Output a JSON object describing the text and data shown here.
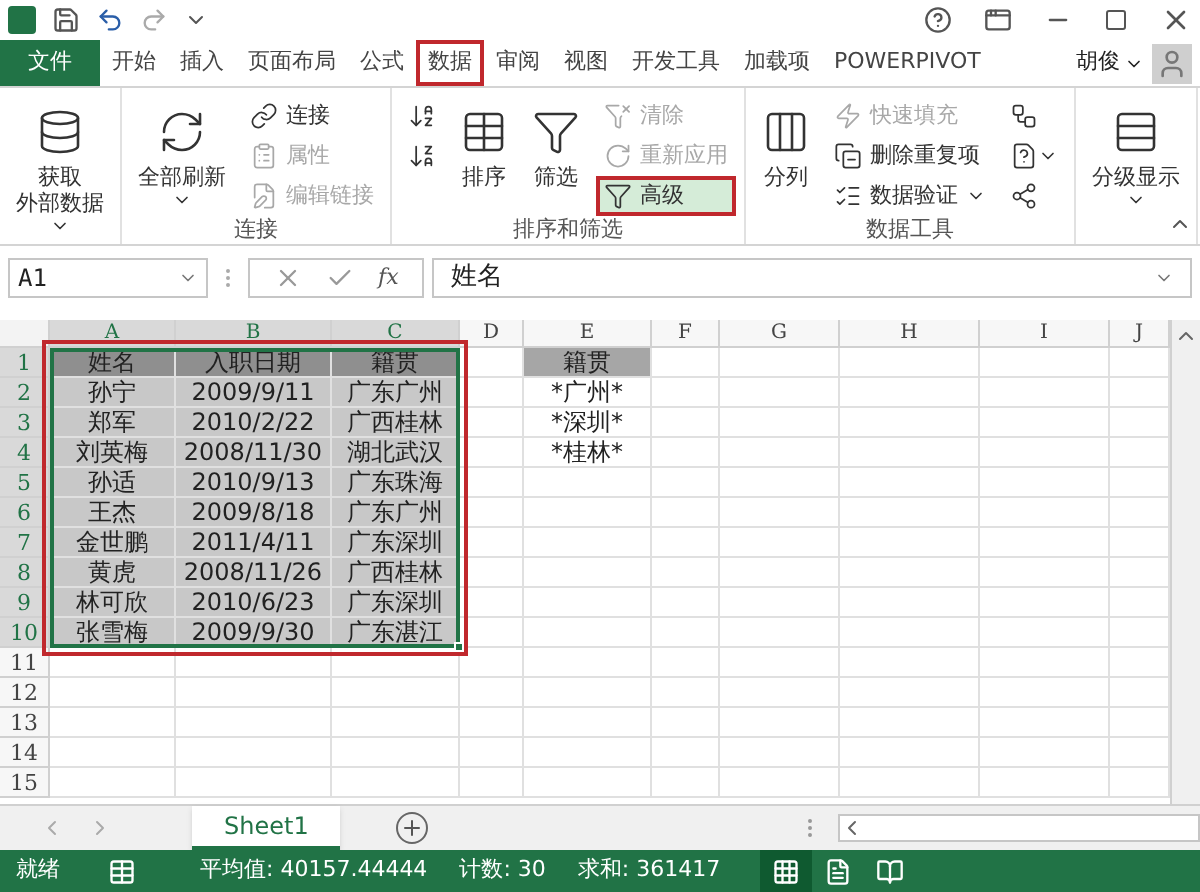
{
  "tabs": [
    {
      "label": "文件",
      "kind": "file",
      "selected": false
    },
    {
      "label": "开始",
      "kind": "tab",
      "selected": false
    },
    {
      "label": "插入",
      "kind": "tab",
      "selected": false
    },
    {
      "label": "页面布局",
      "kind": "tab",
      "selected": false
    },
    {
      "label": "公式",
      "kind": "tab",
      "selected": false
    },
    {
      "label": "数据",
      "kind": "tab",
      "selected": true
    },
    {
      "label": "审阅",
      "kind": "tab",
      "selected": false
    },
    {
      "label": "视图",
      "kind": "tab",
      "selected": false
    },
    {
      "label": "开发工具",
      "kind": "tab",
      "selected": false
    },
    {
      "label": "加载项",
      "kind": "tab",
      "selected": false
    },
    {
      "label": "POWERPIVOT",
      "kind": "tab",
      "selected": false
    }
  ],
  "user": {
    "name": "胡俊"
  },
  "ribbon": {
    "groups": [
      {
        "stacks": [
          [
            {
              "kind": "large",
              "lines": [
                "获取",
                "外部数据"
              ],
              "dropdown": true,
              "disabled": false,
              "highlighted": false
            }
          ]
        ]
      },
      {
        "label": "连接",
        "stacks": [
          [
            {
              "kind": "large",
              "lines": [
                "全部刷新"
              ],
              "dropdown": true,
              "disabled": false,
              "highlighted": false
            }
          ],
          [
            {
              "kind": "small",
              "lines": [
                "连接"
              ],
              "dropdown": false,
              "disabled": false,
              "highlighted": false
            },
            {
              "kind": "small",
              "lines": [
                "属性"
              ],
              "dropdown": false,
              "disabled": true,
              "highlighted": false
            },
            {
              "kind": "small",
              "lines": [
                "编辑链接"
              ],
              "dropdown": false,
              "disabled": true,
              "highlighted": false
            }
          ]
        ]
      },
      {
        "label": "排序和筛选",
        "stacks": [
          [
            {
              "kind": "icon",
              "dropdown": false,
              "disabled": false,
              "highlighted": false
            },
            {
              "kind": "icon",
              "dropdown": false,
              "disabled": false,
              "highlighted": false
            }
          ],
          [
            {
              "kind": "large",
              "lines": [
                "排序"
              ],
              "dropdown": false,
              "disabled": false,
              "highlighted": false
            }
          ],
          [
            {
              "kind": "large",
              "lines": [
                "筛选"
              ],
              "dropdown": false,
              "disabled": false,
              "highlighted": false
            }
          ],
          [
            {
              "kind": "small",
              "lines": [
                "清除"
              ],
              "dropdown": false,
              "disabled": true,
              "highlighted": false
            },
            {
              "kind": "small",
              "lines": [
                "重新应用"
              ],
              "dropdown": false,
              "disabled": true,
              "highlighted": false
            },
            {
              "kind": "small",
              "lines": [
                "高级"
              ],
              "dropdown": false,
              "disabled": false,
              "highlighted": true
            }
          ]
        ]
      },
      {
        "label": "数据工具",
        "stacks": [
          [
            {
              "kind": "large",
              "lines": [
                "分列"
              ],
              "dropdown": false,
              "disabled": false,
              "highlighted": false
            }
          ],
          [
            {
              "kind": "small",
              "lines": [
                "快速填充"
              ],
              "dropdown": false,
              "disabled": true,
              "highlighted": false
            },
            {
              "kind": "small",
              "lines": [
                "删除重复项"
              ],
              "dropdown": false,
              "disabled": false,
              "highlighted": false
            },
            {
              "kind": "small",
              "lines": [
                "数据验证"
              ],
              "dropdown": true,
              "disabled": false,
              "highlighted": false
            }
          ],
          [
            {
              "kind": "icon",
              "dropdown": false,
              "disabled": false,
              "highlighted": false
            },
            {
              "kind": "icon",
              "dropdown": true,
              "disabled": false,
              "highlighted": false
            },
            {
              "kind": "icon",
              "dropdown": false,
              "disabled": false,
              "highlighted": false
            }
          ]
        ]
      },
      {
        "stacks": [
          [
            {
              "kind": "large",
              "lines": [
                "分级显示"
              ],
              "dropdown": true,
              "disabled": false,
              "highlighted": false
            }
          ]
        ]
      }
    ]
  },
  "formula_bar": {
    "name_box": "A1",
    "function_label": "fx",
    "value": "姓名"
  },
  "sheet": {
    "columns": [
      "A",
      "B",
      "C",
      "D",
      "E",
      "F",
      "G",
      "H",
      "I",
      "J"
    ],
    "selection_framed": true,
    "rows": [
      {
        "number": "1",
        "cells": [
          {
            "text": "姓名",
            "kind": "header",
            "selected": true
          },
          {
            "text": "入职日期",
            "kind": "header",
            "selected": true
          },
          {
            "text": "籍贯",
            "kind": "header",
            "selected": true
          },
          null,
          {
            "text": "籍贯",
            "kind": "header",
            "selected": false
          }
        ]
      },
      {
        "number": "2",
        "cells": [
          {
            "text": "孙宁",
            "kind": "body",
            "selected": true
          },
          {
            "text": "2009/9/11",
            "kind": "body",
            "selected": true
          },
          {
            "text": "广东广州",
            "kind": "body",
            "selected": true
          },
          null,
          {
            "text": "*广州*",
            "kind": "body",
            "selected": false
          }
        ]
      },
      {
        "number": "3",
        "cells": [
          {
            "text": "郑军",
            "kind": "body",
            "selected": true
          },
          {
            "text": "2010/2/22",
            "kind": "body",
            "selected": true
          },
          {
            "text": "广西桂林",
            "kind": "body",
            "selected": true
          },
          null,
          {
            "text": "*深圳*",
            "kind": "body",
            "selected": false
          }
        ]
      },
      {
        "number": "4",
        "cells": [
          {
            "text": "刘英梅",
            "kind": "body",
            "selected": true
          },
          {
            "text": "2008/11/30",
            "kind": "body",
            "selected": true
          },
          {
            "text": "湖北武汉",
            "kind": "body",
            "selected": true
          },
          null,
          {
            "text": "*桂林*",
            "kind": "body",
            "selected": false
          }
        ]
      },
      {
        "number": "5",
        "cells": [
          {
            "text": "孙适",
            "kind": "body",
            "selected": true
          },
          {
            "text": "2010/9/13",
            "kind": "body",
            "selected": true
          },
          {
            "text": "广东珠海",
            "kind": "body",
            "selected": true
          }
        ]
      },
      {
        "number": "6",
        "cells": [
          {
            "text": "王杰",
            "kind": "body",
            "selected": true
          },
          {
            "text": "2009/8/18",
            "kind": "body",
            "selected": true
          },
          {
            "text": "广东广州",
            "kind": "body",
            "selected": true
          }
        ]
      },
      {
        "number": "7",
        "cells": [
          {
            "text": "金世鹏",
            "kind": "body",
            "selected": true
          },
          {
            "text": "2011/4/11",
            "kind": "body",
            "selected": true
          },
          {
            "text": "广东深圳",
            "kind": "body",
            "selected": true
          }
        ]
      },
      {
        "number": "8",
        "cells": [
          {
            "text": "黄虎",
            "kind": "body",
            "selected": true
          },
          {
            "text": "2008/11/26",
            "kind": "body",
            "selected": true
          },
          {
            "text": "广西桂林",
            "kind": "body",
            "selected": true
          }
        ]
      },
      {
        "number": "9",
        "cells": [
          {
            "text": "林可欣",
            "kind": "body",
            "selected": true
          },
          {
            "text": "2010/6/23",
            "kind": "body",
            "selected": true
          },
          {
            "text": "广东深圳",
            "kind": "body",
            "selected": true
          }
        ]
      },
      {
        "number": "10",
        "cells": [
          {
            "text": "张雪梅",
            "kind": "body",
            "selected": true
          },
          {
            "text": "2009/9/30",
            "kind": "body",
            "selected": true
          },
          {
            "text": "广东湛江",
            "kind": "body",
            "selected": true
          }
        ]
      },
      {
        "number": "11",
        "cells": []
      },
      {
        "number": "12",
        "cells": []
      },
      {
        "number": "13",
        "cells": []
      },
      {
        "number": "14",
        "cells": []
      },
      {
        "number": "15",
        "cells": []
      }
    ]
  },
  "sheet_tabs": [
    {
      "label": "Sheet1",
      "selected": true
    }
  ],
  "status_bar": {
    "ready": "就绪",
    "stats": [
      "平均值: 40157.44444",
      "计数: 30",
      "求和: 361417"
    ],
    "views": [
      {
        "selected": true
      },
      {
        "selected": false
      },
      {
        "selected": false
      }
    ]
  }
}
